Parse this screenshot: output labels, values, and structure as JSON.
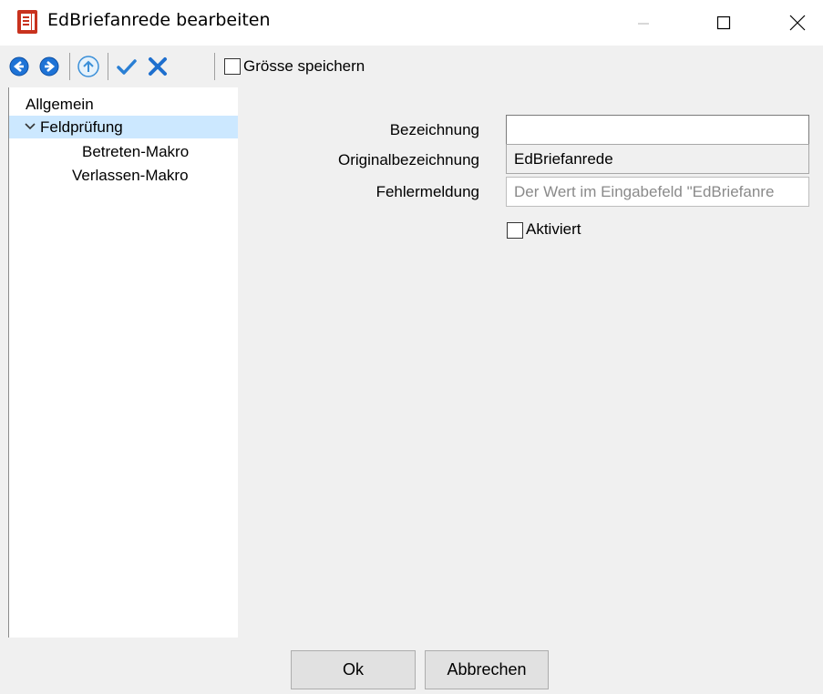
{
  "window": {
    "title": "EdBriefanrede bearbeiten",
    "icon": "document-icon",
    "accent_color": "#c42b1c"
  },
  "toolbar": {
    "icons": [
      "back-circle-icon",
      "forward-circle-icon",
      "up-circle-icon",
      "checkmark-icon",
      "cross-icon"
    ],
    "save_size_label": "Grösse speichern",
    "save_size_checked": false
  },
  "tree": {
    "items": [
      {
        "label": "Allgemein",
        "expanded": null,
        "selected": false
      },
      {
        "label": "Feldprüfung",
        "expanded": true,
        "selected": true
      },
      {
        "label": "Betreten-Makro",
        "expanded": null,
        "selected": false
      },
      {
        "label": "Verlassen-Makro",
        "expanded": null,
        "selected": false
      }
    ]
  },
  "form": {
    "bezeichnung_label": "Bezeichnung",
    "bezeichnung_value": "",
    "original_label": "Originalbezeichnung",
    "original_value": "EdBriefanrede",
    "fehler_label": "Fehlermeldung",
    "fehler_value": "Der Wert im Eingabefeld \"EdBriefanre",
    "aktiviert_label": "Aktiviert",
    "aktiviert_checked": false
  },
  "buttons": {
    "ok": "Ok",
    "cancel": "Abbrechen"
  }
}
